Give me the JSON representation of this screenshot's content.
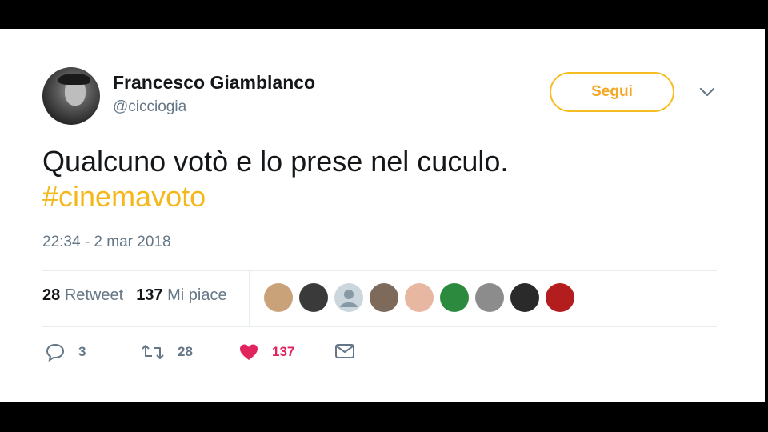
{
  "author": {
    "name": "Francesco Giamblanco",
    "handle": "@cicciogia"
  },
  "follow_button": {
    "label": "Segui"
  },
  "tweet": {
    "text": "Qualcuno votò e lo prese nel cuculo.",
    "hashtag": "#cinemavoto",
    "timestamp": "22:34 - 2 mar 2018"
  },
  "stats": {
    "retweets_count": "28",
    "retweets_label": "Retweet",
    "likes_count": "137",
    "likes_label": "Mi piace"
  },
  "likers": [
    {
      "color": "#c9a27a"
    },
    {
      "color": "#3a3a3a"
    },
    {
      "color": "#ccd6dd"
    },
    {
      "color": "#7d6a5a"
    },
    {
      "color": "#e7b7a2"
    },
    {
      "color": "#2b8a3e"
    },
    {
      "color": "#8c8c8c"
    },
    {
      "color": "#2a2a2a"
    },
    {
      "color": "#b31d1d"
    }
  ],
  "actions": {
    "reply_count": "3",
    "retweet_count": "28",
    "like_count": "137"
  },
  "colors": {
    "accent": "#f5b81c",
    "like": "#e0245e",
    "muted": "#657786"
  }
}
